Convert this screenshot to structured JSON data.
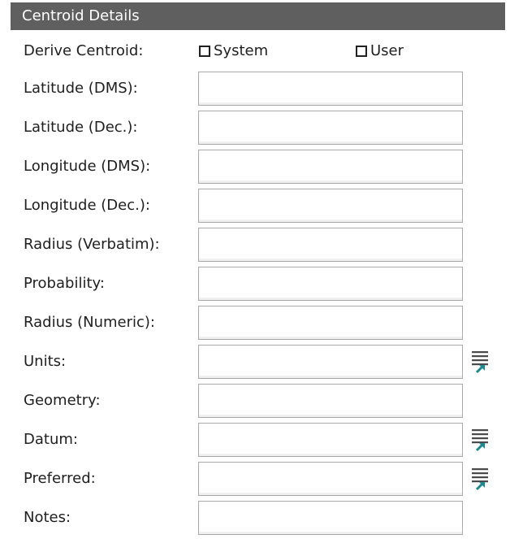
{
  "header": {
    "title": "Centroid Details"
  },
  "derive": {
    "label": "Derive Centroid:",
    "options": [
      {
        "label": "System",
        "checked": false
      },
      {
        "label": "User",
        "checked": false
      }
    ]
  },
  "fields": [
    {
      "label": "Latitude (DMS):",
      "value": ""
    },
    {
      "label": "Latitude (Dec.):",
      "value": ""
    },
    {
      "label": "Longitude (DMS):",
      "value": ""
    },
    {
      "label": "Longitude (Dec.):",
      "value": ""
    },
    {
      "label": "Radius (Verbatim):",
      "value": ""
    },
    {
      "label": "Probability:",
      "value": ""
    },
    {
      "label": "Radius (Numeric):",
      "value": ""
    },
    {
      "label": "Units:",
      "value": "",
      "icon": "list-picker-icon"
    },
    {
      "label": "Geometry:",
      "value": ""
    },
    {
      "label": "Datum:",
      "value": "",
      "icon": "list-picker-icon"
    },
    {
      "label": "Preferred:",
      "value": "",
      "icon": "list-picker-icon"
    },
    {
      "label": "Notes:",
      "value": ""
    }
  ],
  "colors": {
    "header_bg": "#5f5f5f",
    "icon_lines": "#4a4a4a",
    "icon_arrow": "#1b8a8f"
  }
}
